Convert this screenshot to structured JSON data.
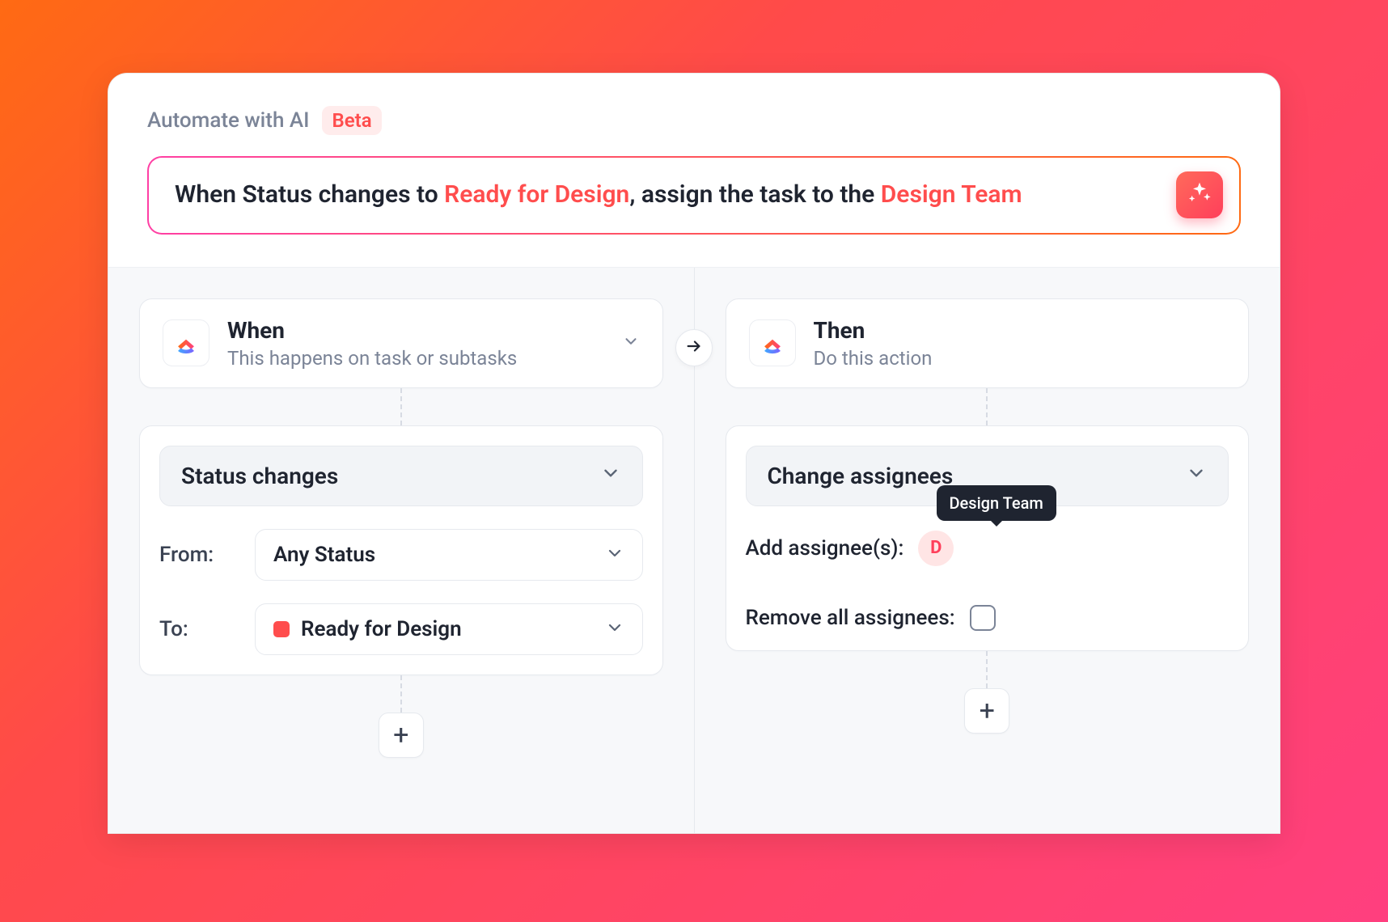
{
  "header": {
    "title": "Automate with AI",
    "badge": "Beta"
  },
  "prompt": {
    "part1": "When Status changes to ",
    "hl1": "Ready for Design",
    "part2": ", assign the task to the ",
    "hl2": "Design Team"
  },
  "when": {
    "title": "When",
    "subtitle": "This happens on task or subtasks",
    "select": "Status changes",
    "from_label": "From:",
    "from_value": "Any Status",
    "to_label": "To:",
    "to_value": "Ready for Design",
    "to_color": "#ff4d4d"
  },
  "then": {
    "title": "Then",
    "subtitle": "Do this action",
    "select": "Change assignees",
    "add_label": "Add assignee(s):",
    "assignee_initial": "D",
    "assignee_tooltip": "Design Team",
    "remove_label": "Remove all assignees:"
  },
  "buttons": {
    "add": "+"
  }
}
